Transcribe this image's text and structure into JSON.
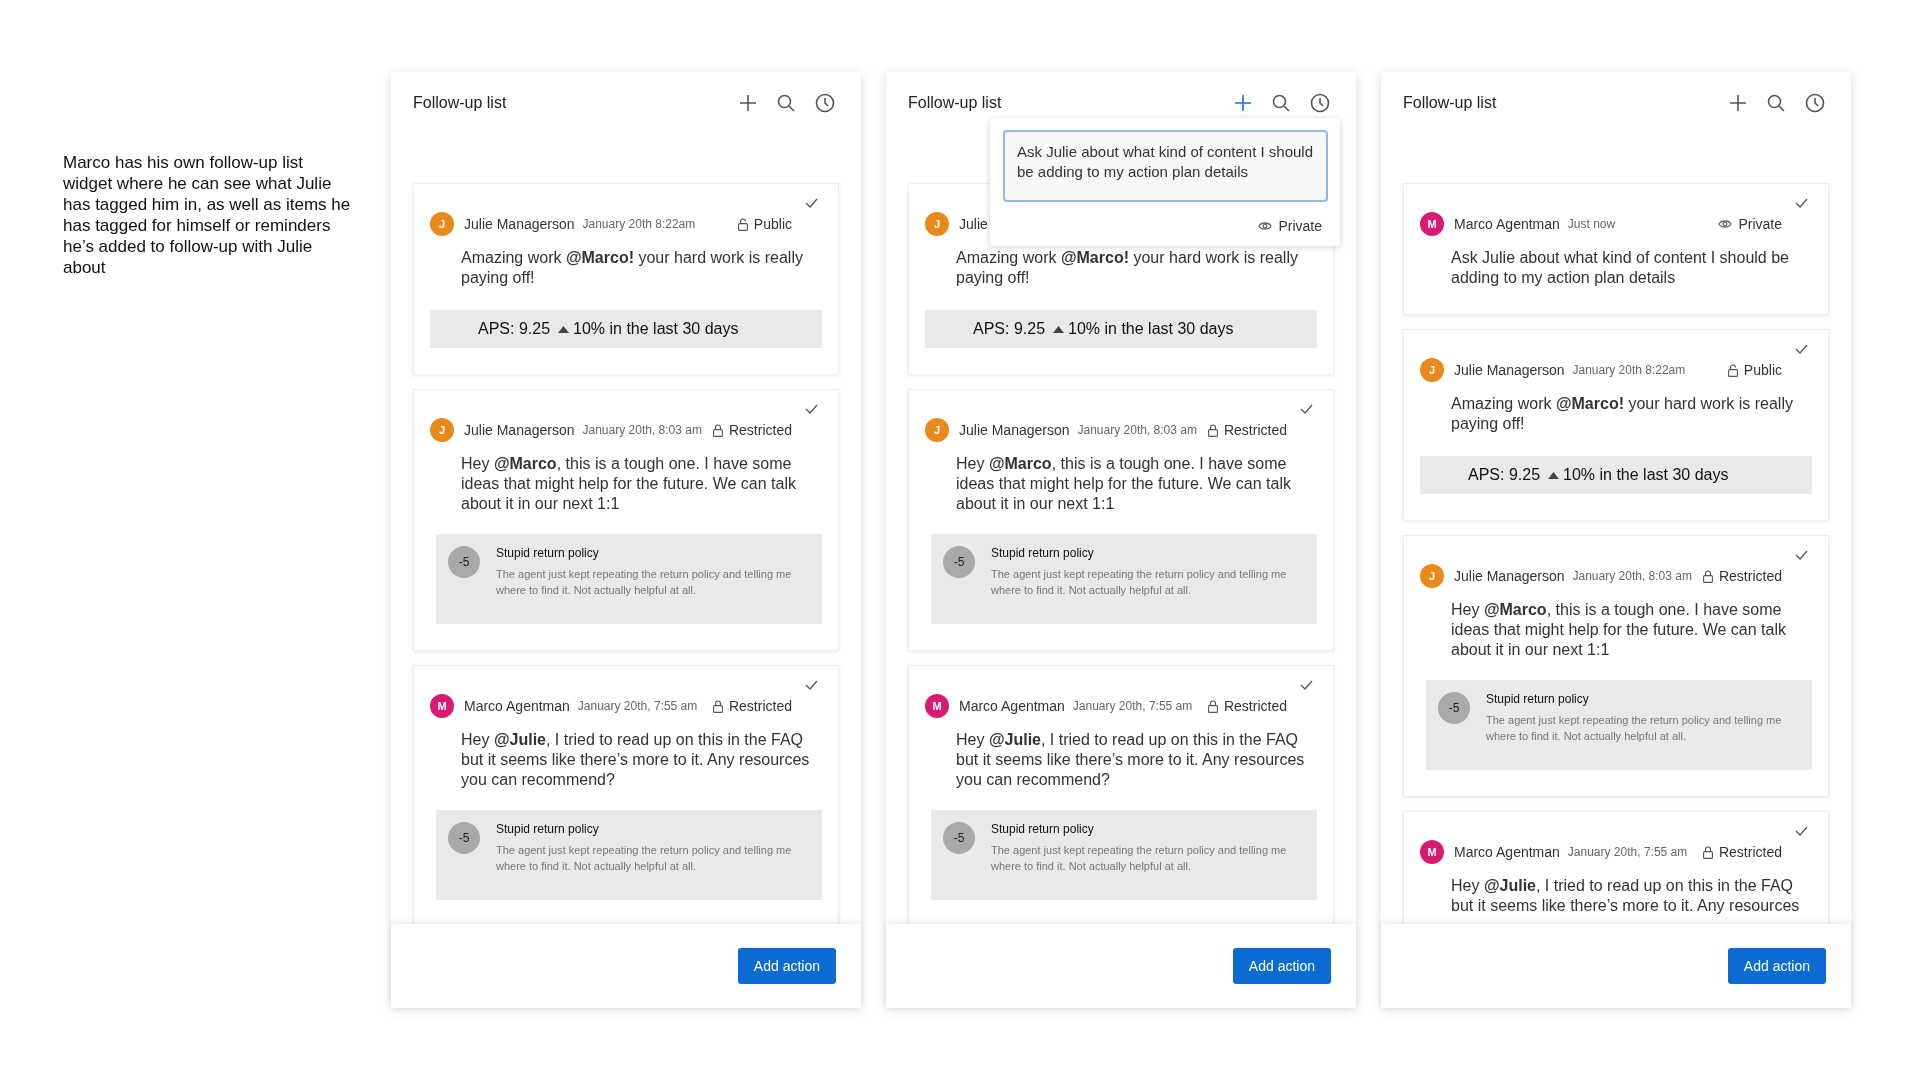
{
  "caption": "Marco has his own follow-up list widget where he can see what Julie has tagged him in, as well as items he has tagged for himself or reminders he’s added to follow-up with Julie about",
  "panels": [
    {
      "title": "Follow-up list",
      "add_selected": false,
      "items": [
        {
          "avatar": "J",
          "color": "#e8891a",
          "author": "Julie Managerson",
          "date": "January 20th 8:22am",
          "visibility": {
            "kind": "public",
            "label": "Public"
          },
          "message": "Amazing work **@Marco!** your hard work is really paying off!",
          "attachment": {
            "kind": "metric",
            "value": "APS: 9.25",
            "change": "10% in the last 30 days"
          }
        },
        {
          "avatar": "J",
          "color": "#e8891a",
          "author": "Julie Managerson",
          "date": "January 20th, 8:03 am",
          "visibility": {
            "kind": "restricted",
            "label": "Restricted"
          },
          "message": "Hey **@Marco**, this is a tough one. I have some ideas that might help for the future. We can talk about it in our next 1:1",
          "attachment": {
            "kind": "feedback",
            "score": "-5",
            "title": "Stupid return policy",
            "text": "The agent just kept repeating the return policy and telling me where to find it. Not actually helpful at all."
          }
        },
        {
          "avatar": "M",
          "color": "#d81b72",
          "author": "Marco Agentman",
          "date": "January 20th, 7:55 am",
          "visibility": {
            "kind": "restricted",
            "label": "Restricted"
          },
          "message": "Hey **@Julie**, I tried to read up on this in the FAQ but it seems like there’s more to it. Any resources you can recommend?",
          "attachment": {
            "kind": "feedback",
            "score": "-5",
            "title": "Stupid return policy",
            "text": "The agent just kept repeating the return policy and telling me where to find it. Not actually helpful at all."
          }
        }
      ],
      "button": "Add action"
    },
    {
      "title": "Follow-up list",
      "add_selected": true,
      "popover": {
        "value": "Ask Julie about what kind of content I should be adding to my action plan details",
        "visibility": {
          "kind": "private",
          "label": "Private"
        }
      },
      "items": [
        {
          "avatar": "J",
          "color": "#e8891a",
          "author": "Julie",
          "message": "Amazing work **@Marco!** your hard work is really paying off!",
          "attachment": {
            "kind": "metric",
            "value": "APS: 9.25",
            "change": "10% in the last 30 days"
          }
        },
        {
          "avatar": "J",
          "color": "#e8891a",
          "author": "Julie Managerson",
          "date": "January 20th, 8:03 am",
          "visibility": {
            "kind": "restricted",
            "label": "Restricted"
          },
          "message": "Hey **@Marco**, this is a tough one. I have some ideas that might help for the future. We can talk about it in our next 1:1",
          "attachment": {
            "kind": "feedback",
            "score": "-5",
            "title": "Stupid return policy",
            "text": "The agent just kept repeating the return policy and telling me where to find it. Not actually helpful at all."
          }
        },
        {
          "avatar": "M",
          "color": "#d81b72",
          "author": "Marco Agentman",
          "date": "January 20th, 7:55 am",
          "visibility": {
            "kind": "restricted",
            "label": "Restricted"
          },
          "message": "Hey **@Julie**, I tried to read up on this in the FAQ but it seems like there’s more to it. Any resources you can recommend?",
          "attachment": {
            "kind": "feedback",
            "score": "-5",
            "title": "Stupid return policy",
            "text": "The agent just kept repeating the return policy and telling me where to find it. Not actually helpful at all."
          }
        }
      ],
      "button": "Add action"
    },
    {
      "title": "Follow-up list",
      "add_selected": false,
      "items": [
        {
          "avatar": "M",
          "color": "#d81b72",
          "author": "Marco Agentman",
          "date": "Just now",
          "visibility": {
            "kind": "private",
            "label": "Private"
          },
          "message": "Ask Julie about what kind of content I should be adding to my action plan details"
        },
        {
          "avatar": "J",
          "color": "#e8891a",
          "author": "Julie Managerson",
          "date": "January 20th 8:22am",
          "visibility": {
            "kind": "public",
            "label": "Public"
          },
          "message": "Amazing work **@Marco!** your hard work is really paying off!",
          "attachment": {
            "kind": "metric",
            "value": "APS: 9.25",
            "change": "10% in the last 30 days"
          }
        },
        {
          "avatar": "J",
          "color": "#e8891a",
          "author": "Julie Managerson",
          "date": "January 20th, 8:03 am",
          "visibility": {
            "kind": "restricted",
            "label": "Restricted"
          },
          "message": "Hey **@Marco**, this is a tough one. I have some ideas that might help for the future. We can talk about it in our next 1:1",
          "attachment": {
            "kind": "feedback",
            "score": "-5",
            "title": "Stupid return policy",
            "text": "The agent just kept repeating the return policy and telling me where to find it. Not actually helpful at all."
          }
        },
        {
          "avatar": "M",
          "color": "#d81b72",
          "author": "Marco Agentman",
          "date": "January 20th, 7:55 am",
          "visibility": {
            "kind": "restricted",
            "label": "Restricted"
          },
          "message": "Hey **@Julie**, I tried to read up on this in the FAQ but it seems like there’s more to it. Any resources"
        }
      ],
      "button": "Add action"
    }
  ]
}
